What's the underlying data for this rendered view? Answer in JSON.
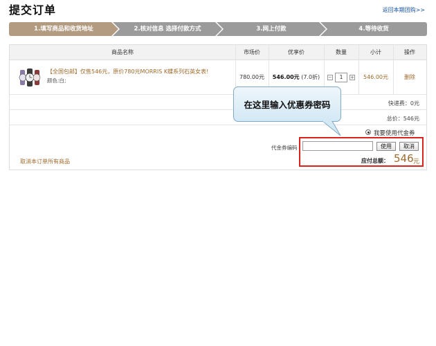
{
  "header": {
    "title": "提交订单",
    "back_link": "返回本期团购>>"
  },
  "steps": [
    {
      "label": "1.填写商品和收货地址",
      "active": true
    },
    {
      "label": "2.核对信息 选择付款方式",
      "active": false
    },
    {
      "label": "3.网上付款",
      "active": false
    },
    {
      "label": "4.等待收货",
      "active": false
    }
  ],
  "table": {
    "columns": [
      "商品名称",
      "市场价",
      "优享价",
      "数量",
      "小计",
      "操作"
    ],
    "item": {
      "title": "【全国包邮】仅售546元，原价780元MORRIS K蝶系列石英女表!",
      "color": "颜色:白;",
      "market_price": "780.00元",
      "price": "546.00元",
      "discount": "(7.0折)",
      "quantity": "1",
      "subtotal": "546.00元",
      "delete_label": "删除"
    },
    "shipping": "快递费：0元",
    "total": "总价：546元"
  },
  "coupon": {
    "radio_label": "我要使用代金券",
    "field_label": "代金券编码",
    "input_value": "",
    "use_button": "使用",
    "cancel_button": "取消",
    "payable_label": "应付总额：",
    "payable_value": "546",
    "payable_unit": "元"
  },
  "cancel_all": "取消本订单所有商品",
  "tooltip": "在这里输入优惠券密码",
  "colors": {
    "active_step": "#b29b80",
    "inactive_step": "#9b9b9b",
    "highlight_border": "#d9231c",
    "price_brown": "#a06a2c",
    "link_blue": "#1a56a8"
  }
}
